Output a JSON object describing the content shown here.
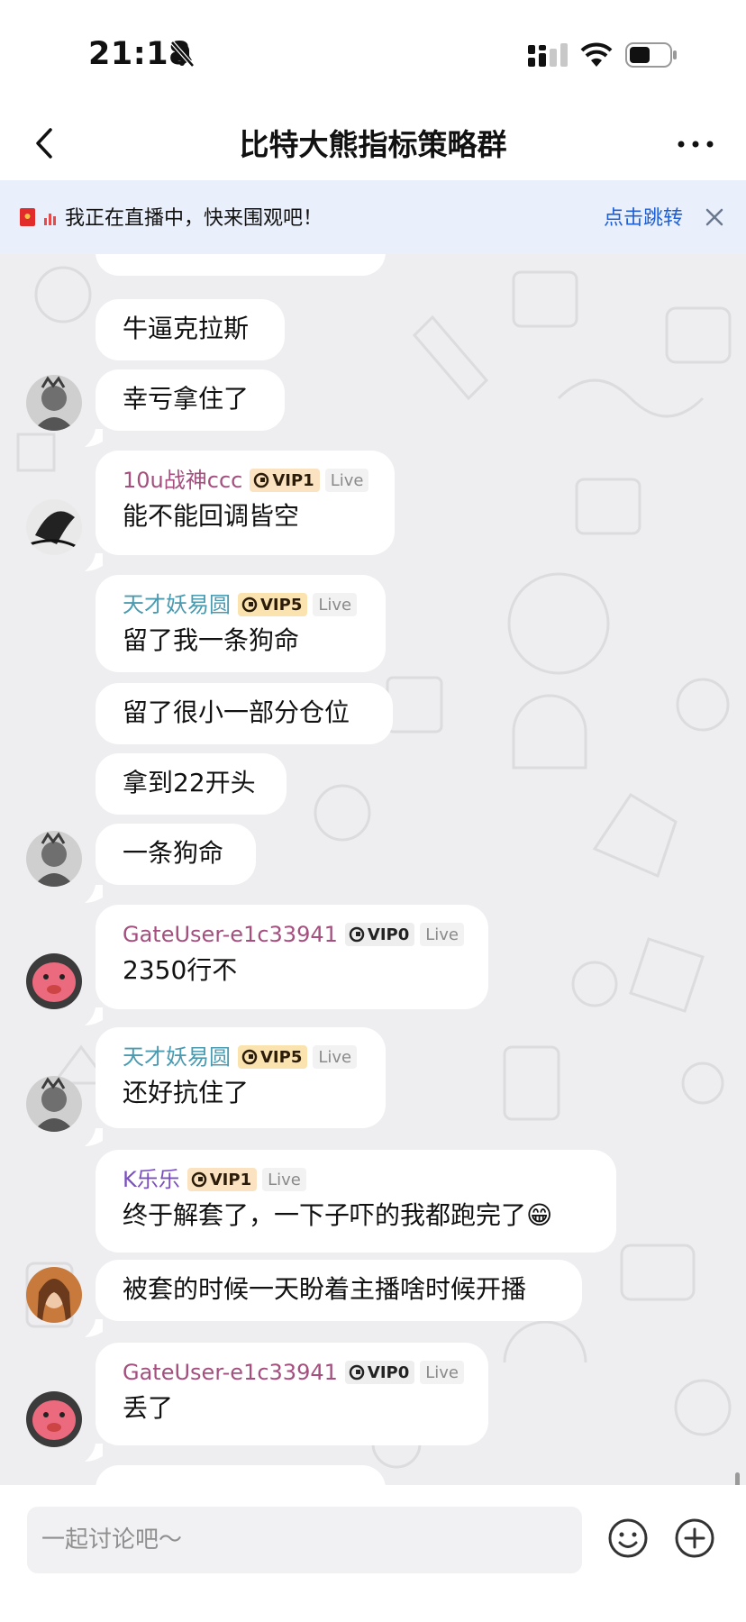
{
  "status_bar": {
    "time": "21:18"
  },
  "header": {
    "title": "比特大熊指标策略群"
  },
  "banner": {
    "text": "我正在直播中，快来围观吧！",
    "link": "点击跳转"
  },
  "messages": [
    {
      "text": "牛逼克拉斯"
    },
    {
      "text": "幸亏拿住了"
    },
    {
      "user": "10u战神ccc",
      "vip": "VIP1",
      "badge": "Live",
      "text": "能不能回调皆空"
    },
    {
      "user": "天才妖易圆",
      "vip": "VIP5",
      "badge": "Live",
      "text": "留了我一条狗命"
    },
    {
      "text": "留了很小一部分仓位"
    },
    {
      "text": "拿到22开头"
    },
    {
      "text": "一条狗命"
    },
    {
      "user": "GateUser-e1c33941",
      "vip": "VIP0",
      "badge": "Live",
      "text": "2350行不"
    },
    {
      "user": "天才妖易圆",
      "vip": "VIP5",
      "badge": "Live",
      "text": "还好抗住了"
    },
    {
      "user": "K乐乐",
      "vip": "VIP1",
      "badge": "Live",
      "text": "终于解套了，一下子吓的我都跑完了😁"
    },
    {
      "text": "被套的时候一天盼着主播啥时候开播"
    },
    {
      "user": "GateUser-e1c33941",
      "vip": "VIP0",
      "badge": "Live",
      "text": "丢了"
    }
  ],
  "composer": {
    "placeholder": "一起讨论吧～"
  },
  "colors": {
    "banner_bg": "#eaf0fb",
    "link_blue": "#1f5fd6",
    "name_pink": "#a44f7e",
    "name_teal": "#4a9ab0",
    "name_purple": "#7a4fc0"
  }
}
